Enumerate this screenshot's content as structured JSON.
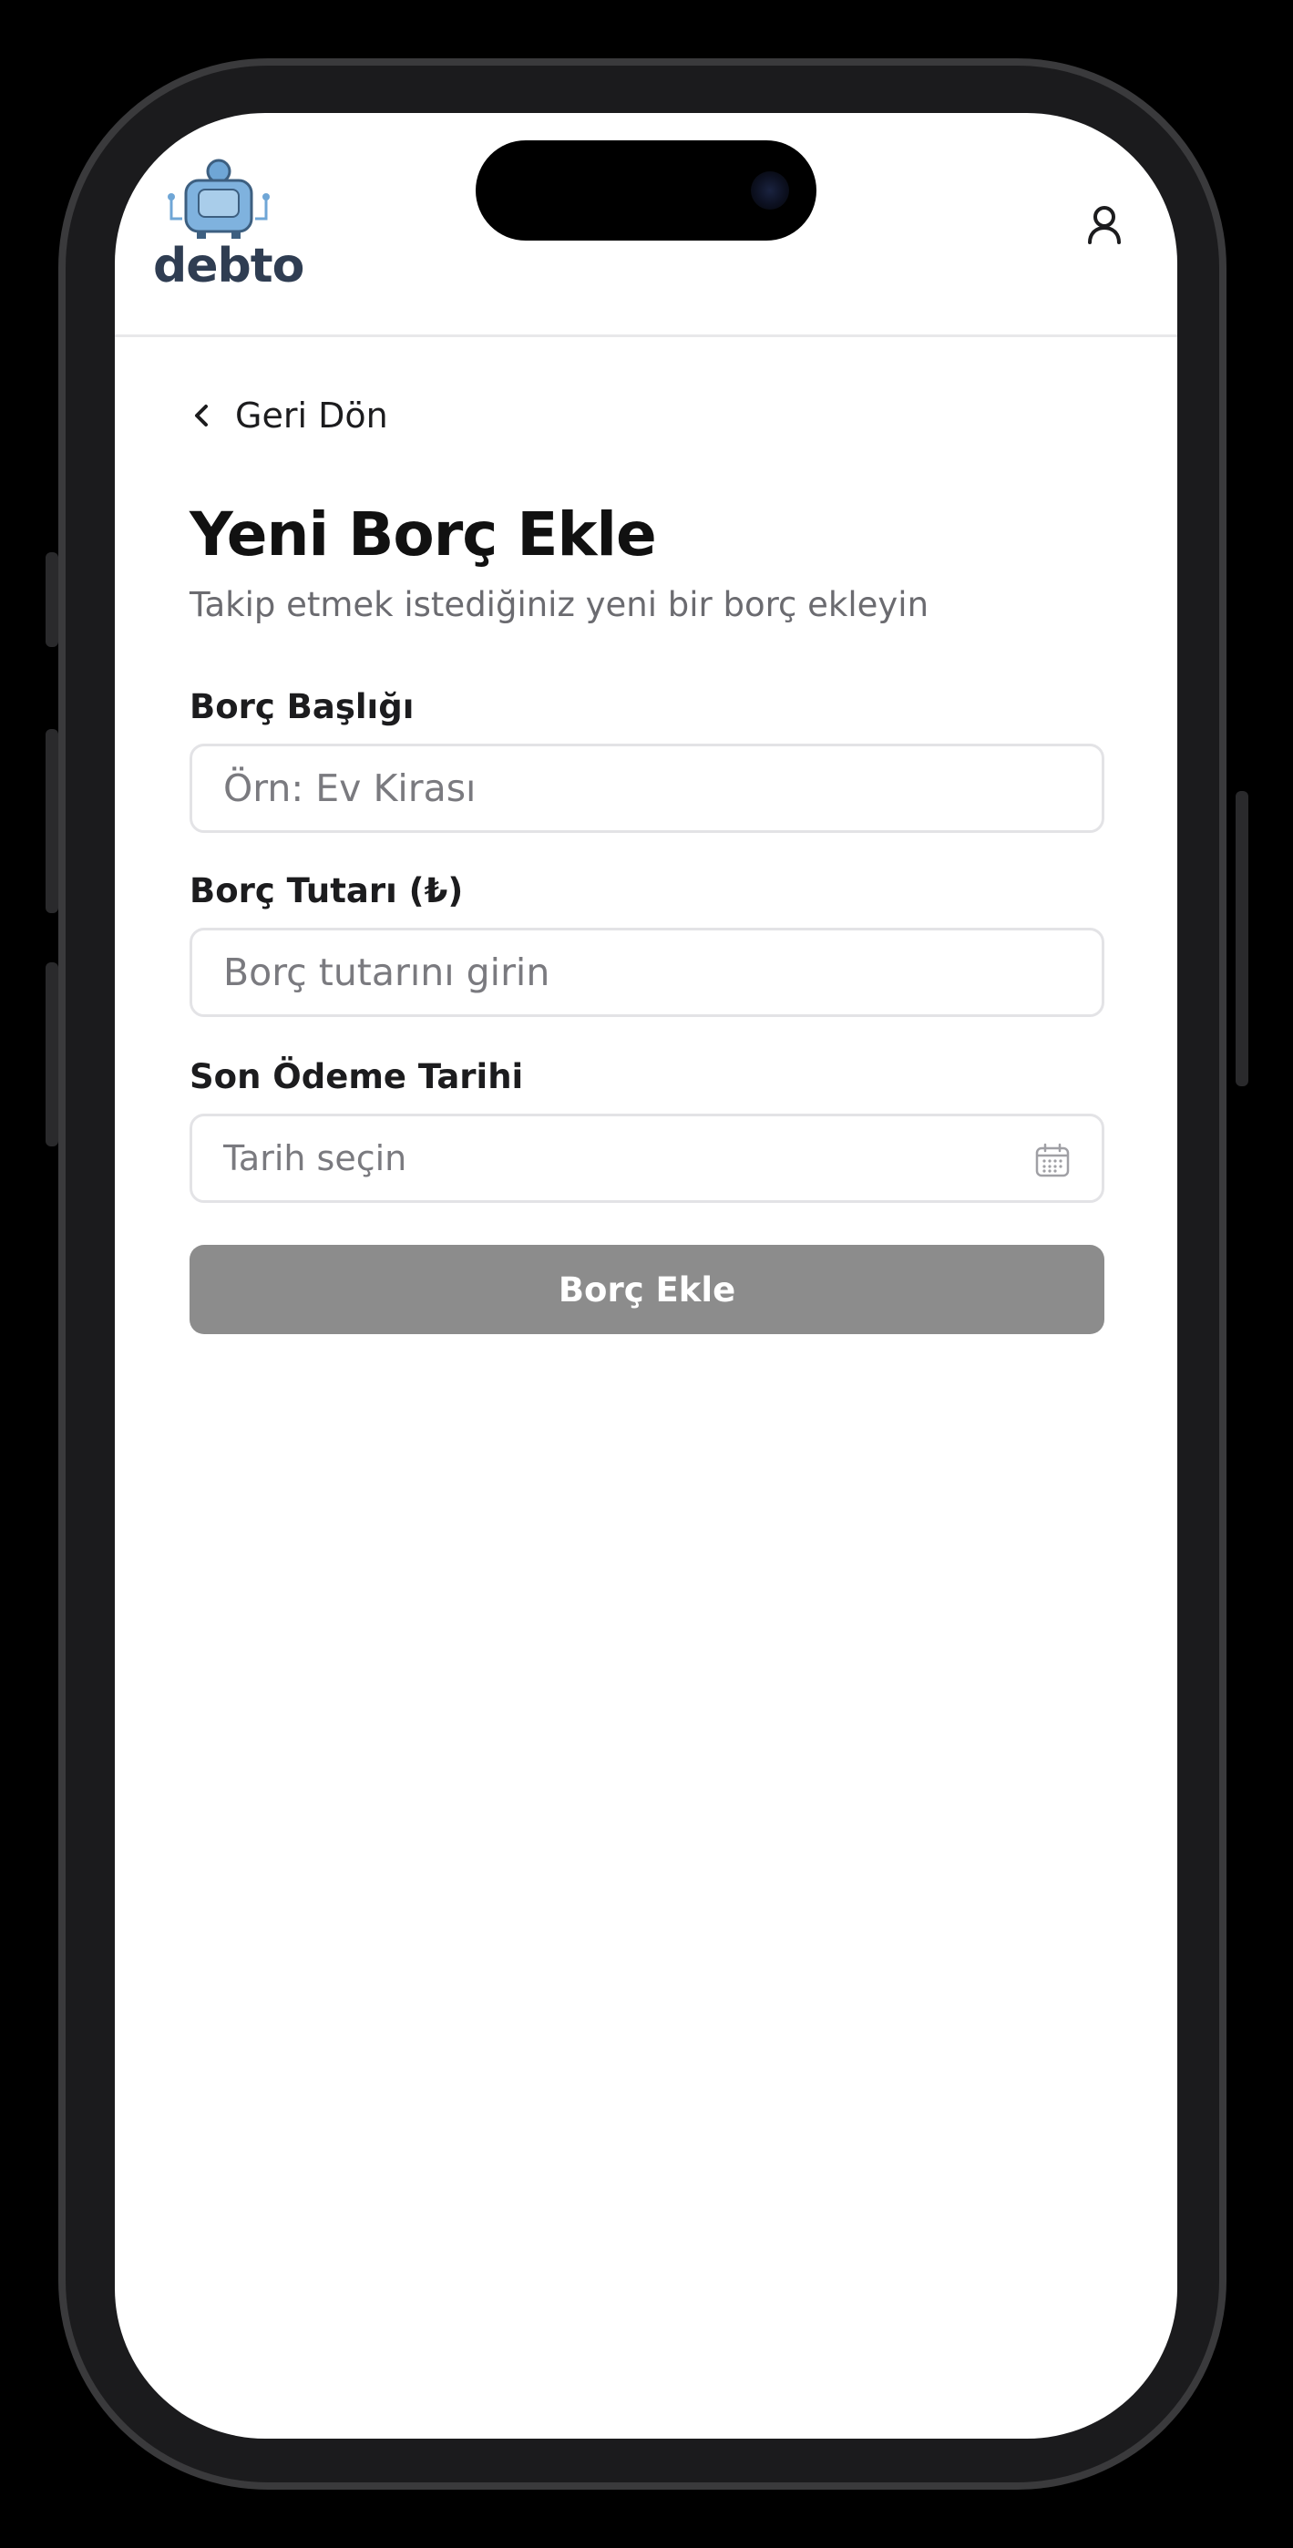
{
  "header": {
    "logo_text": "debto"
  },
  "nav": {
    "back_label": "Geri Dön"
  },
  "page": {
    "title": "Yeni Borç Ekle",
    "subtitle": "Takip etmek istediğiniz yeni bir borç ekleyin"
  },
  "form": {
    "title_field": {
      "label": "Borç Başlığı",
      "placeholder": "Örn: Ev Kirası",
      "value": ""
    },
    "amount_field": {
      "label": "Borç Tutarı (₺)",
      "placeholder": "Borç tutarını girin",
      "value": ""
    },
    "date_field": {
      "label": "Son Ödeme Tarihi",
      "placeholder": "Tarih seçin",
      "value": ""
    },
    "submit_label": "Borç Ekle"
  },
  "icons": {
    "back": "chevron-left-icon",
    "user": "user-icon",
    "calendar": "calendar-icon"
  },
  "colors": {
    "submit_disabled": "#8c8c8c",
    "logo_accent": "#6fa6d6",
    "logo_text": "#2f3d52"
  }
}
